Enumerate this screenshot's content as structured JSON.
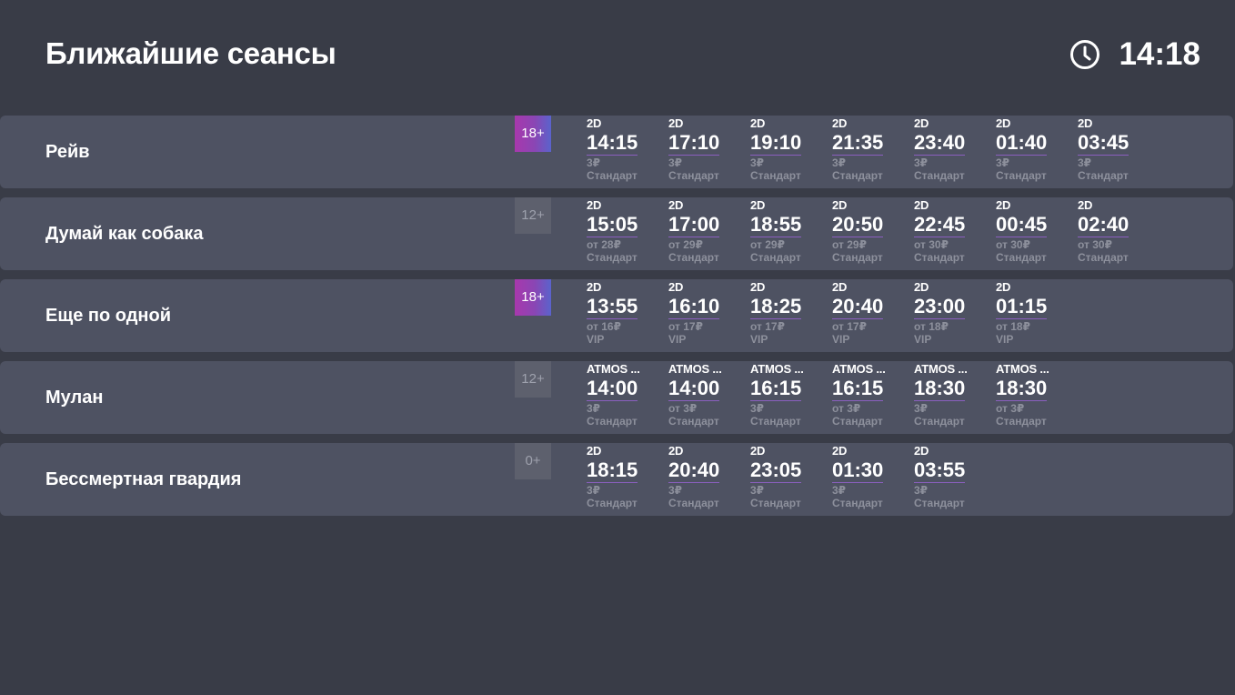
{
  "header": {
    "title": "Ближайшие сеансы",
    "time": "14:18",
    "clock_icon": "clock-icon"
  },
  "colors": {
    "background": "#393c47",
    "row": "#4e5262",
    "badge_adult_from": "#a838ad",
    "badge_adult_to": "#5a63cc",
    "badge_default": "#5d606d",
    "muted_text": "#8d909c",
    "time_underline": "#8b5fbf"
  },
  "movies": [
    {
      "title": "Рейв",
      "age": "18+",
      "adult": true,
      "sessions": [
        {
          "format": "2D",
          "time": "14:15",
          "price": "3₽",
          "hall": "Стандарт"
        },
        {
          "format": "2D",
          "time": "17:10",
          "price": "3₽",
          "hall": "Стандарт"
        },
        {
          "format": "2D",
          "time": "19:10",
          "price": "3₽",
          "hall": "Стандарт"
        },
        {
          "format": "2D",
          "time": "21:35",
          "price": "3₽",
          "hall": "Стандарт"
        },
        {
          "format": "2D",
          "time": "23:40",
          "price": "3₽",
          "hall": "Стандарт"
        },
        {
          "format": "2D",
          "time": "01:40",
          "price": "3₽",
          "hall": "Стандарт"
        },
        {
          "format": "2D",
          "time": "03:45",
          "price": "3₽",
          "hall": "Стандарт"
        }
      ]
    },
    {
      "title": "Думай как собака",
      "age": "12+",
      "adult": false,
      "sessions": [
        {
          "format": "2D",
          "time": "15:05",
          "price": "от 28₽",
          "hall": "Стандарт"
        },
        {
          "format": "2D",
          "time": "17:00",
          "price": "от 29₽",
          "hall": "Стандарт"
        },
        {
          "format": "2D",
          "time": "18:55",
          "price": "от 29₽",
          "hall": "Стандарт"
        },
        {
          "format": "2D",
          "time": "20:50",
          "price": "от 29₽",
          "hall": "Стандарт"
        },
        {
          "format": "2D",
          "time": "22:45",
          "price": "от 30₽",
          "hall": "Стандарт"
        },
        {
          "format": "2D",
          "time": "00:45",
          "price": "от 30₽",
          "hall": "Стандарт"
        },
        {
          "format": "2D",
          "time": "02:40",
          "price": "от 30₽",
          "hall": "Стандарт"
        }
      ]
    },
    {
      "title": "Еще по одной",
      "age": "18+",
      "adult": true,
      "sessions": [
        {
          "format": "2D",
          "time": "13:55",
          "price": "от 16₽",
          "hall": "VIP"
        },
        {
          "format": "2D",
          "time": "16:10",
          "price": "от 17₽",
          "hall": "VIP"
        },
        {
          "format": "2D",
          "time": "18:25",
          "price": "от 17₽",
          "hall": "VIP"
        },
        {
          "format": "2D",
          "time": "20:40",
          "price": "от 17₽",
          "hall": "VIP"
        },
        {
          "format": "2D",
          "time": "23:00",
          "price": "от 18₽",
          "hall": "VIP"
        },
        {
          "format": "2D",
          "time": "01:15",
          "price": "от 18₽",
          "hall": "VIP"
        }
      ]
    },
    {
      "title": "Мулан",
      "age": "12+",
      "adult": false,
      "sessions": [
        {
          "format": "ATMOS ...",
          "time": "14:00",
          "price": "3₽",
          "hall": "Стандарт"
        },
        {
          "format": "ATMOS ...",
          "time": "14:00",
          "price": "от 3₽",
          "hall": "Стандарт"
        },
        {
          "format": "ATMOS ...",
          "time": "16:15",
          "price": "3₽",
          "hall": "Стандарт"
        },
        {
          "format": "ATMOS ...",
          "time": "16:15",
          "price": "от 3₽",
          "hall": "Стандарт"
        },
        {
          "format": "ATMOS ...",
          "time": "18:30",
          "price": "3₽",
          "hall": "Стандарт"
        },
        {
          "format": "ATMOS ...",
          "time": "18:30",
          "price": "от 3₽",
          "hall": "Стандарт"
        }
      ]
    },
    {
      "title": "Бессмертная гвардия",
      "age": "0+",
      "adult": false,
      "sessions": [
        {
          "format": "2D",
          "time": "18:15",
          "price": "3₽",
          "hall": "Стандарт"
        },
        {
          "format": "2D",
          "time": "20:40",
          "price": "3₽",
          "hall": "Стандарт"
        },
        {
          "format": "2D",
          "time": "23:05",
          "price": "3₽",
          "hall": "Стандарт"
        },
        {
          "format": "2D",
          "time": "01:30",
          "price": "3₽",
          "hall": "Стандарт"
        },
        {
          "format": "2D",
          "time": "03:55",
          "price": "3₽",
          "hall": "Стандарт"
        }
      ]
    }
  ]
}
